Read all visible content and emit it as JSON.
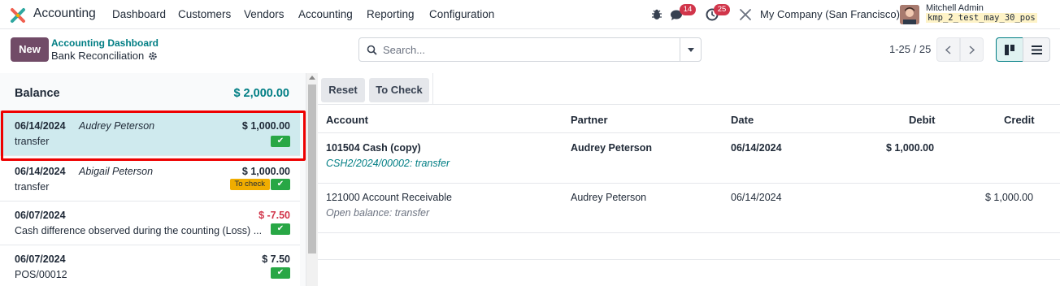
{
  "navbar": {
    "app_name": "Accounting",
    "menu": [
      "Dashboard",
      "Customers",
      "Vendors",
      "Accounting",
      "Reporting",
      "Configuration"
    ],
    "messages_badge": "14",
    "activities_badge": "25",
    "company": "My Company (San Francisco)",
    "user_name": "Mitchell Admin",
    "db_name": "kmp_2_test_may_30_pos",
    "icons": [
      "bug-icon",
      "chat-icon",
      "clock-icon",
      "tools-icon"
    ]
  },
  "control": {
    "new_label": "New",
    "breadcrumb_parent": "Accounting Dashboard",
    "breadcrumb_current": "Bank Reconciliation",
    "search_placeholder": "Search...",
    "pager": "1-25 / 25"
  },
  "left_panel": {
    "balance_label": "Balance",
    "balance_value": "$ 2,000.00",
    "lines": [
      {
        "date": "06/14/2024",
        "partner": "Audrey Peterson",
        "amount": "$ 1,000.00",
        "label": "transfer",
        "to_check": "",
        "selected": true
      },
      {
        "date": "06/14/2024",
        "partner": "Abigail Peterson",
        "amount": "$ 1,000.00",
        "label": "transfer",
        "to_check": "To check",
        "selected": false
      },
      {
        "date": "06/07/2024",
        "partner": "",
        "amount": "$ -7.50",
        "label": "Cash difference observed during the counting (Loss) ...",
        "to_check": "",
        "selected": false
      },
      {
        "date": "06/07/2024",
        "partner": "",
        "amount": "$ 7.50",
        "label": "POS/00012",
        "to_check": "",
        "selected": false
      }
    ]
  },
  "right_panel": {
    "reset_label": "Reset",
    "to_check_label": "To Check",
    "columns": [
      "Account",
      "Partner",
      "Date",
      "Debit",
      "Credit"
    ],
    "rows": [
      {
        "account": "101504 Cash (copy)",
        "sub": "CSH2/2024/00002: transfer",
        "partner": "Audrey Peterson",
        "date": "06/14/2024",
        "debit": "$ 1,000.00",
        "credit": ""
      },
      {
        "account": "121000 Account Receivable",
        "sub": "Open balance: transfer",
        "partner": "Audrey Peterson",
        "date": "06/14/2024",
        "debit": "",
        "credit": "$ 1,000.00"
      }
    ]
  },
  "colors": {
    "brand": "#714b67",
    "accent": "#017e84",
    "negative": "#d1354a",
    "check": "#28a745",
    "warning": "#f0ad00"
  }
}
